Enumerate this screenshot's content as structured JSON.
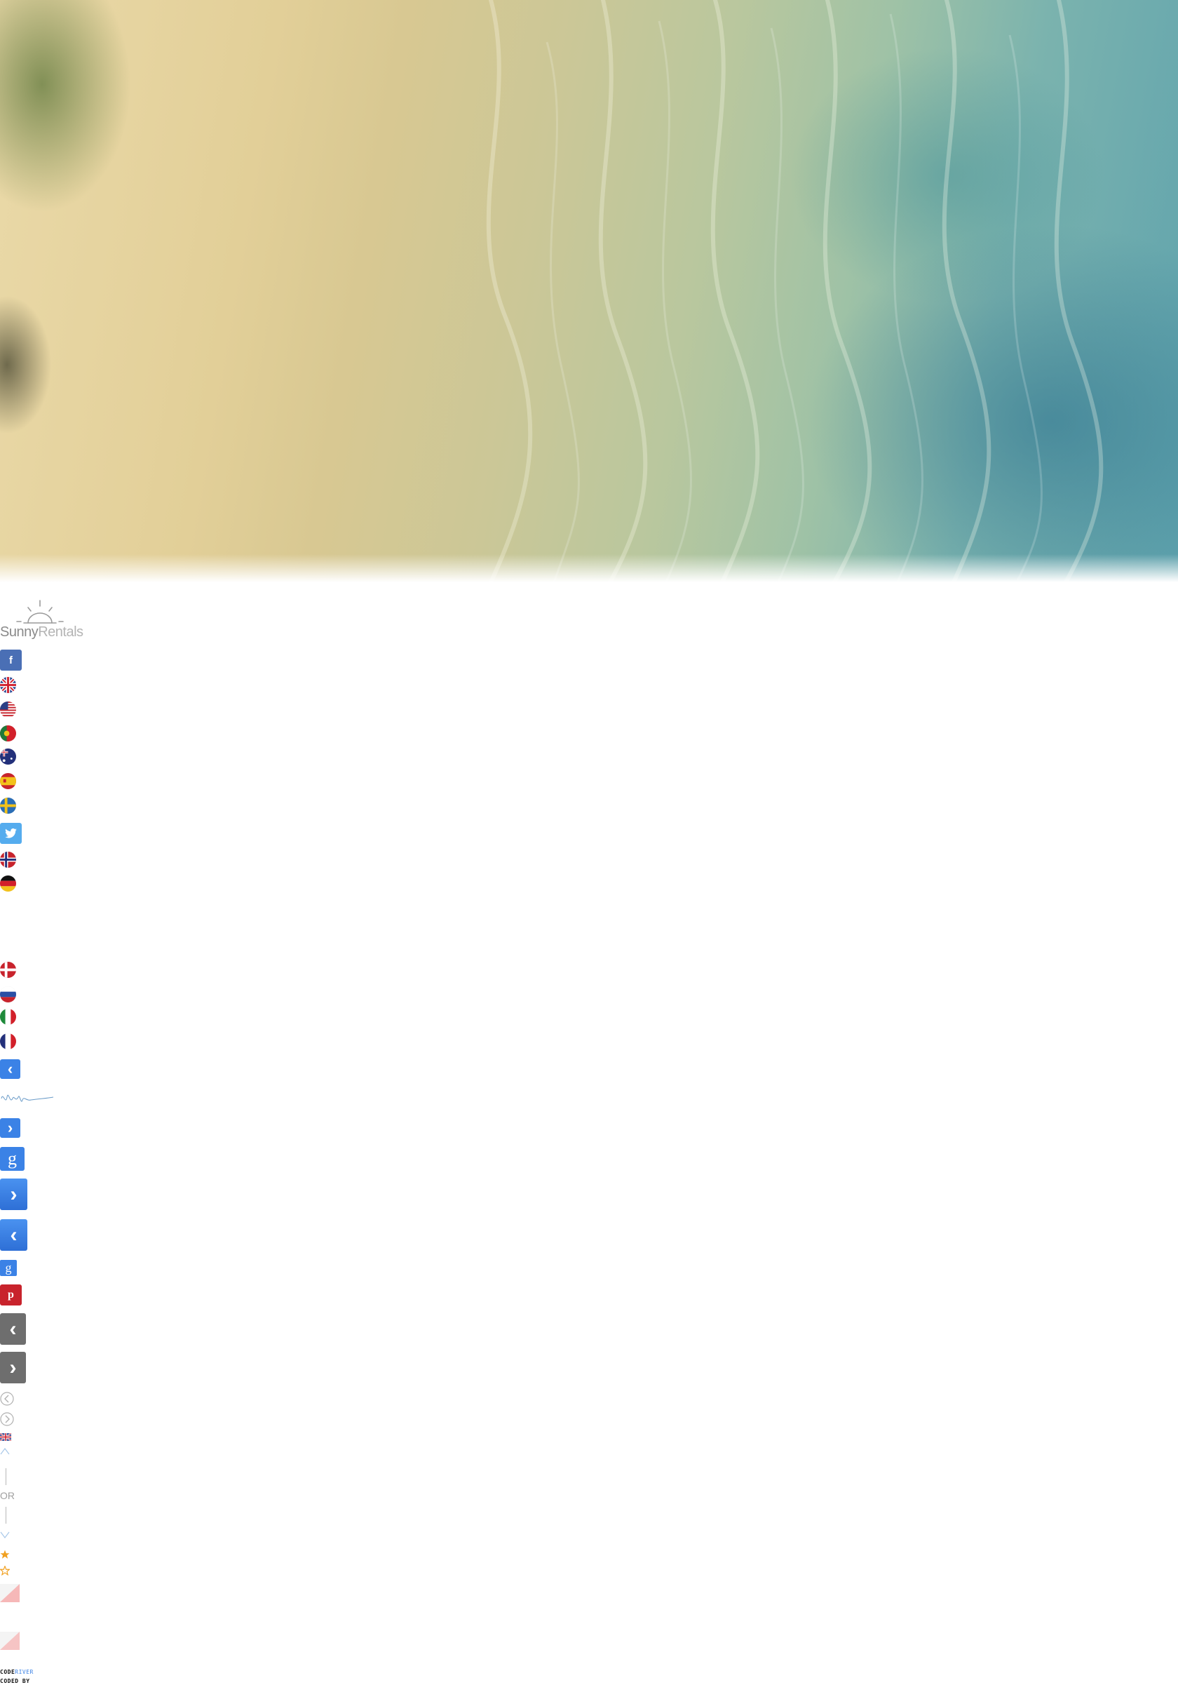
{
  "brand": {
    "name_part1": "Sunny",
    "name_part2": "Rentals"
  },
  "social": {
    "facebook_icon": "f",
    "google_icon": "g",
    "pinterest_icon": "p"
  },
  "flags": [
    "uk",
    "usa",
    "portugal",
    "australia",
    "spain",
    "sweden",
    "norway",
    "germany",
    "denmark",
    "russia",
    "italy",
    "france"
  ],
  "controls": {
    "prev_glyph": "‹",
    "next_glyph": "›",
    "separator_text": "OR"
  },
  "footer": {
    "code_label": "CODE",
    "river_label": "RIVER",
    "coded_by_label": "CODED BY"
  },
  "colors": {
    "facebook": "#4a6fb5",
    "twitter": "#55acee",
    "blue_button": "#3b82e6",
    "pinterest": "#c8232c",
    "grey_button": "#6e6e6e",
    "star": "#f0a020"
  }
}
